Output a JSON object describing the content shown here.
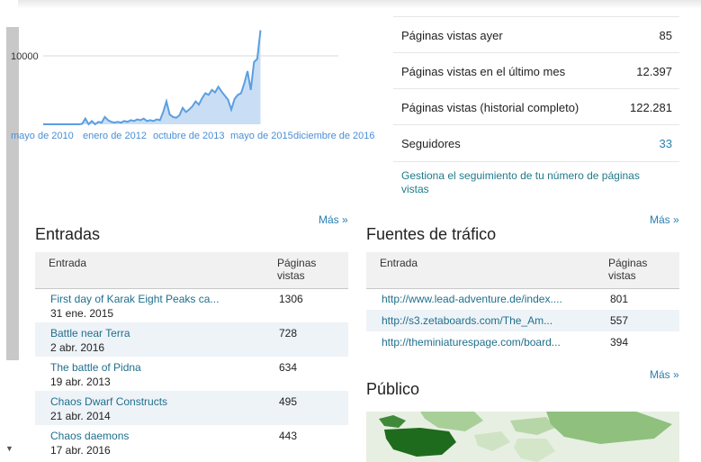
{
  "chart_data": {
    "type": "area",
    "title": "",
    "xlabel": "",
    "ylabel": "",
    "y_ticks": [
      "10000"
    ],
    "x_tick_labels": [
      "mayo de 2010",
      "enero de 2012",
      "octubre de 2013",
      "mayo de 2015",
      "diciembre de 2016"
    ],
    "x": [
      0,
      4,
      8,
      12,
      16,
      20,
      24,
      28,
      32,
      36,
      40,
      44,
      48,
      52,
      56,
      60,
      64,
      68,
      72,
      76,
      80,
      84,
      88,
      92,
      96,
      100,
      104,
      108,
      112,
      116,
      120,
      124,
      128,
      132,
      136,
      140,
      144,
      148,
      152,
      156,
      160,
      164,
      168,
      172,
      176,
      180,
      184,
      188,
      192,
      196,
      200,
      204,
      208,
      212,
      216,
      220,
      224,
      228,
      232,
      236,
      240,
      244,
      248,
      252,
      256,
      260,
      264,
      268,
      272,
      276,
      280,
      284,
      288,
      292,
      296,
      300,
      304,
      308,
      312,
      316,
      320,
      324,
      328,
      332,
      336,
      340,
      344,
      348,
      352,
      356,
      360,
      364
    ],
    "values": [
      0,
      0,
      0,
      0,
      0,
      0,
      0,
      0,
      0,
      0,
      0,
      0,
      50,
      700,
      0,
      400,
      0,
      300,
      200,
      900,
      500,
      300,
      200,
      300,
      200,
      400,
      300,
      500,
      400,
      600,
      500,
      700,
      400,
      500,
      400,
      600,
      500,
      1500,
      2800,
      1200,
      900,
      800,
      1100,
      2000,
      1500,
      1800,
      2200,
      2800,
      2400,
      3200,
      3800,
      3600,
      4200,
      3900,
      4600,
      4000,
      3500,
      3000,
      1800,
      3100,
      3600,
      3800,
      5000,
      6500,
      4200,
      7600,
      8000,
      11500
    ],
    "ylim": [
      0,
      13000
    ],
    "grid": true,
    "colors": {
      "line": "#5b9fe0",
      "fill": "#c9def5"
    }
  },
  "stats": [
    {
      "label": "Páginas vistas ayer",
      "value": "85"
    },
    {
      "label": "Páginas vistas en el último mes",
      "value": "12.397"
    },
    {
      "label": "Páginas vistas (historial completo)",
      "value": "122.281"
    },
    {
      "label": "Seguidores",
      "value": "33"
    }
  ],
  "manage_link": "Gestiona el seguimiento de tu número de páginas vistas",
  "more_label": "Más »",
  "entradas": {
    "title": "Entradas",
    "col_entrada": "Entrada",
    "col_pv_1": "Páginas",
    "col_pv_2": "vistas",
    "rows": [
      {
        "title": "First day of Karak Eight Peaks ca...",
        "date": "31 ene. 2015",
        "views": "1306"
      },
      {
        "title": "Battle near Terra",
        "date": "2 abr. 2016",
        "views": "728"
      },
      {
        "title": "The battle of Pidna",
        "date": "19 abr. 2013",
        "views": "634"
      },
      {
        "title": "Chaos Dwarf Constructs",
        "date": "21 abr. 2014",
        "views": "495"
      },
      {
        "title": "Chaos daemons",
        "date": "17 abr. 2016",
        "views": "443"
      }
    ]
  },
  "fuentes": {
    "title": "Fuentes de tráfico",
    "col_entrada": "Entrada",
    "col_pv_1": "Páginas",
    "col_pv_2": "vistas",
    "rows": [
      {
        "url": "http://www.lead-adventure.de/index....",
        "views": "801"
      },
      {
        "url": "http://s3.zetaboards.com/The_Am...",
        "views": "557"
      },
      {
        "url": "http://theminiaturespage.com/board...",
        "views": "394"
      }
    ]
  },
  "publico": {
    "title": "Público"
  }
}
